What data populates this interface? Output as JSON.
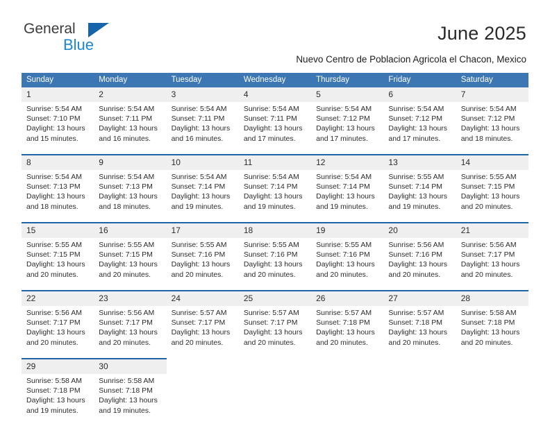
{
  "brand": {
    "name_part1": "General",
    "name_part2": "Blue",
    "triangle_color": "#1665ac",
    "blue_color": "#1b87d4"
  },
  "header": {
    "month_title": "June 2025",
    "location": "Nuevo Centro de Poblacion Agricola el Chacon, Mexico"
  },
  "theme": {
    "header_bg": "#3c77b4",
    "row_divider": "#1d63a8",
    "daynum_bg": "#efefef"
  },
  "weekday_headers": [
    "Sunday",
    "Monday",
    "Tuesday",
    "Wednesday",
    "Thursday",
    "Friday",
    "Saturday"
  ],
  "weeks": [
    {
      "days": [
        {
          "num": "1",
          "sunrise": "Sunrise: 5:54 AM",
          "sunset": "Sunset: 7:10 PM",
          "daylight_l1": "Daylight: 13 hours",
          "daylight_l2": "and 15 minutes."
        },
        {
          "num": "2",
          "sunrise": "Sunrise: 5:54 AM",
          "sunset": "Sunset: 7:11 PM",
          "daylight_l1": "Daylight: 13 hours",
          "daylight_l2": "and 16 minutes."
        },
        {
          "num": "3",
          "sunrise": "Sunrise: 5:54 AM",
          "sunset": "Sunset: 7:11 PM",
          "daylight_l1": "Daylight: 13 hours",
          "daylight_l2": "and 16 minutes."
        },
        {
          "num": "4",
          "sunrise": "Sunrise: 5:54 AM",
          "sunset": "Sunset: 7:11 PM",
          "daylight_l1": "Daylight: 13 hours",
          "daylight_l2": "and 17 minutes."
        },
        {
          "num": "5",
          "sunrise": "Sunrise: 5:54 AM",
          "sunset": "Sunset: 7:12 PM",
          "daylight_l1": "Daylight: 13 hours",
          "daylight_l2": "and 17 minutes."
        },
        {
          "num": "6",
          "sunrise": "Sunrise: 5:54 AM",
          "sunset": "Sunset: 7:12 PM",
          "daylight_l1": "Daylight: 13 hours",
          "daylight_l2": "and 17 minutes."
        },
        {
          "num": "7",
          "sunrise": "Sunrise: 5:54 AM",
          "sunset": "Sunset: 7:12 PM",
          "daylight_l1": "Daylight: 13 hours",
          "daylight_l2": "and 18 minutes."
        }
      ]
    },
    {
      "days": [
        {
          "num": "8",
          "sunrise": "Sunrise: 5:54 AM",
          "sunset": "Sunset: 7:13 PM",
          "daylight_l1": "Daylight: 13 hours",
          "daylight_l2": "and 18 minutes."
        },
        {
          "num": "9",
          "sunrise": "Sunrise: 5:54 AM",
          "sunset": "Sunset: 7:13 PM",
          "daylight_l1": "Daylight: 13 hours",
          "daylight_l2": "and 18 minutes."
        },
        {
          "num": "10",
          "sunrise": "Sunrise: 5:54 AM",
          "sunset": "Sunset: 7:14 PM",
          "daylight_l1": "Daylight: 13 hours",
          "daylight_l2": "and 19 minutes."
        },
        {
          "num": "11",
          "sunrise": "Sunrise: 5:54 AM",
          "sunset": "Sunset: 7:14 PM",
          "daylight_l1": "Daylight: 13 hours",
          "daylight_l2": "and 19 minutes."
        },
        {
          "num": "12",
          "sunrise": "Sunrise: 5:54 AM",
          "sunset": "Sunset: 7:14 PM",
          "daylight_l1": "Daylight: 13 hours",
          "daylight_l2": "and 19 minutes."
        },
        {
          "num": "13",
          "sunrise": "Sunrise: 5:55 AM",
          "sunset": "Sunset: 7:14 PM",
          "daylight_l1": "Daylight: 13 hours",
          "daylight_l2": "and 19 minutes."
        },
        {
          "num": "14",
          "sunrise": "Sunrise: 5:55 AM",
          "sunset": "Sunset: 7:15 PM",
          "daylight_l1": "Daylight: 13 hours",
          "daylight_l2": "and 20 minutes."
        }
      ]
    },
    {
      "days": [
        {
          "num": "15",
          "sunrise": "Sunrise: 5:55 AM",
          "sunset": "Sunset: 7:15 PM",
          "daylight_l1": "Daylight: 13 hours",
          "daylight_l2": "and 20 minutes."
        },
        {
          "num": "16",
          "sunrise": "Sunrise: 5:55 AM",
          "sunset": "Sunset: 7:15 PM",
          "daylight_l1": "Daylight: 13 hours",
          "daylight_l2": "and 20 minutes."
        },
        {
          "num": "17",
          "sunrise": "Sunrise: 5:55 AM",
          "sunset": "Sunset: 7:16 PM",
          "daylight_l1": "Daylight: 13 hours",
          "daylight_l2": "and 20 minutes."
        },
        {
          "num": "18",
          "sunrise": "Sunrise: 5:55 AM",
          "sunset": "Sunset: 7:16 PM",
          "daylight_l1": "Daylight: 13 hours",
          "daylight_l2": "and 20 minutes."
        },
        {
          "num": "19",
          "sunrise": "Sunrise: 5:55 AM",
          "sunset": "Sunset: 7:16 PM",
          "daylight_l1": "Daylight: 13 hours",
          "daylight_l2": "and 20 minutes."
        },
        {
          "num": "20",
          "sunrise": "Sunrise: 5:56 AM",
          "sunset": "Sunset: 7:16 PM",
          "daylight_l1": "Daylight: 13 hours",
          "daylight_l2": "and 20 minutes."
        },
        {
          "num": "21",
          "sunrise": "Sunrise: 5:56 AM",
          "sunset": "Sunset: 7:17 PM",
          "daylight_l1": "Daylight: 13 hours",
          "daylight_l2": "and 20 minutes."
        }
      ]
    },
    {
      "days": [
        {
          "num": "22",
          "sunrise": "Sunrise: 5:56 AM",
          "sunset": "Sunset: 7:17 PM",
          "daylight_l1": "Daylight: 13 hours",
          "daylight_l2": "and 20 minutes."
        },
        {
          "num": "23",
          "sunrise": "Sunrise: 5:56 AM",
          "sunset": "Sunset: 7:17 PM",
          "daylight_l1": "Daylight: 13 hours",
          "daylight_l2": "and 20 minutes."
        },
        {
          "num": "24",
          "sunrise": "Sunrise: 5:57 AM",
          "sunset": "Sunset: 7:17 PM",
          "daylight_l1": "Daylight: 13 hours",
          "daylight_l2": "and 20 minutes."
        },
        {
          "num": "25",
          "sunrise": "Sunrise: 5:57 AM",
          "sunset": "Sunset: 7:17 PM",
          "daylight_l1": "Daylight: 13 hours",
          "daylight_l2": "and 20 minutes."
        },
        {
          "num": "26",
          "sunrise": "Sunrise: 5:57 AM",
          "sunset": "Sunset: 7:18 PM",
          "daylight_l1": "Daylight: 13 hours",
          "daylight_l2": "and 20 minutes."
        },
        {
          "num": "27",
          "sunrise": "Sunrise: 5:57 AM",
          "sunset": "Sunset: 7:18 PM",
          "daylight_l1": "Daylight: 13 hours",
          "daylight_l2": "and 20 minutes."
        },
        {
          "num": "28",
          "sunrise": "Sunrise: 5:58 AM",
          "sunset": "Sunset: 7:18 PM",
          "daylight_l1": "Daylight: 13 hours",
          "daylight_l2": "and 20 minutes."
        }
      ]
    },
    {
      "days": [
        {
          "num": "29",
          "sunrise": "Sunrise: 5:58 AM",
          "sunset": "Sunset: 7:18 PM",
          "daylight_l1": "Daylight: 13 hours",
          "daylight_l2": "and 19 minutes."
        },
        {
          "num": "30",
          "sunrise": "Sunrise: 5:58 AM",
          "sunset": "Sunset: 7:18 PM",
          "daylight_l1": "Daylight: 13 hours",
          "daylight_l2": "and 19 minutes."
        },
        {
          "num": "",
          "sunrise": "",
          "sunset": "",
          "daylight_l1": "",
          "daylight_l2": ""
        },
        {
          "num": "",
          "sunrise": "",
          "sunset": "",
          "daylight_l1": "",
          "daylight_l2": ""
        },
        {
          "num": "",
          "sunrise": "",
          "sunset": "",
          "daylight_l1": "",
          "daylight_l2": ""
        },
        {
          "num": "",
          "sunrise": "",
          "sunset": "",
          "daylight_l1": "",
          "daylight_l2": ""
        },
        {
          "num": "",
          "sunrise": "",
          "sunset": "",
          "daylight_l1": "",
          "daylight_l2": ""
        }
      ]
    }
  ]
}
